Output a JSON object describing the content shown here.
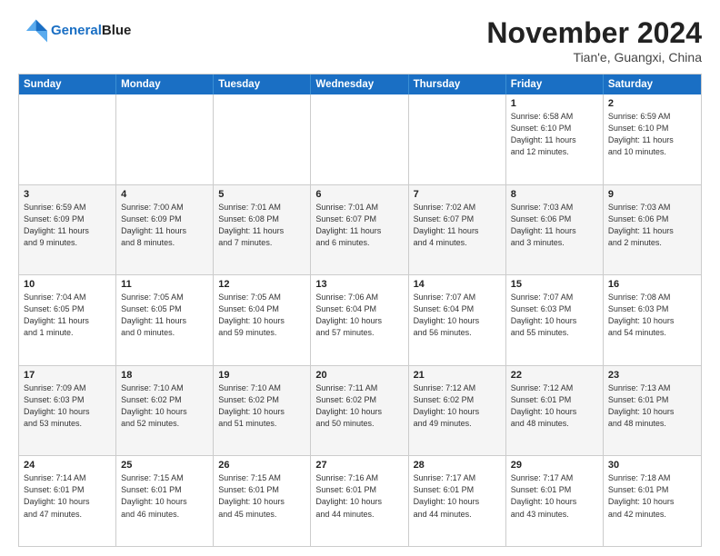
{
  "header": {
    "logo_line1": "General",
    "logo_line2": "Blue",
    "month_title": "November 2024",
    "location": "Tian'e, Guangxi, China"
  },
  "weekdays": [
    "Sunday",
    "Monday",
    "Tuesday",
    "Wednesday",
    "Thursday",
    "Friday",
    "Saturday"
  ],
  "rows": [
    [
      {
        "day": "",
        "info": ""
      },
      {
        "day": "",
        "info": ""
      },
      {
        "day": "",
        "info": ""
      },
      {
        "day": "",
        "info": ""
      },
      {
        "day": "",
        "info": ""
      },
      {
        "day": "1",
        "info": "Sunrise: 6:58 AM\nSunset: 6:10 PM\nDaylight: 11 hours\nand 12 minutes."
      },
      {
        "day": "2",
        "info": "Sunrise: 6:59 AM\nSunset: 6:10 PM\nDaylight: 11 hours\nand 10 minutes."
      }
    ],
    [
      {
        "day": "3",
        "info": "Sunrise: 6:59 AM\nSunset: 6:09 PM\nDaylight: 11 hours\nand 9 minutes."
      },
      {
        "day": "4",
        "info": "Sunrise: 7:00 AM\nSunset: 6:09 PM\nDaylight: 11 hours\nand 8 minutes."
      },
      {
        "day": "5",
        "info": "Sunrise: 7:01 AM\nSunset: 6:08 PM\nDaylight: 11 hours\nand 7 minutes."
      },
      {
        "day": "6",
        "info": "Sunrise: 7:01 AM\nSunset: 6:07 PM\nDaylight: 11 hours\nand 6 minutes."
      },
      {
        "day": "7",
        "info": "Sunrise: 7:02 AM\nSunset: 6:07 PM\nDaylight: 11 hours\nand 4 minutes."
      },
      {
        "day": "8",
        "info": "Sunrise: 7:03 AM\nSunset: 6:06 PM\nDaylight: 11 hours\nand 3 minutes."
      },
      {
        "day": "9",
        "info": "Sunrise: 7:03 AM\nSunset: 6:06 PM\nDaylight: 11 hours\nand 2 minutes."
      }
    ],
    [
      {
        "day": "10",
        "info": "Sunrise: 7:04 AM\nSunset: 6:05 PM\nDaylight: 11 hours\nand 1 minute."
      },
      {
        "day": "11",
        "info": "Sunrise: 7:05 AM\nSunset: 6:05 PM\nDaylight: 11 hours\nand 0 minutes."
      },
      {
        "day": "12",
        "info": "Sunrise: 7:05 AM\nSunset: 6:04 PM\nDaylight: 10 hours\nand 59 minutes."
      },
      {
        "day": "13",
        "info": "Sunrise: 7:06 AM\nSunset: 6:04 PM\nDaylight: 10 hours\nand 57 minutes."
      },
      {
        "day": "14",
        "info": "Sunrise: 7:07 AM\nSunset: 6:04 PM\nDaylight: 10 hours\nand 56 minutes."
      },
      {
        "day": "15",
        "info": "Sunrise: 7:07 AM\nSunset: 6:03 PM\nDaylight: 10 hours\nand 55 minutes."
      },
      {
        "day": "16",
        "info": "Sunrise: 7:08 AM\nSunset: 6:03 PM\nDaylight: 10 hours\nand 54 minutes."
      }
    ],
    [
      {
        "day": "17",
        "info": "Sunrise: 7:09 AM\nSunset: 6:03 PM\nDaylight: 10 hours\nand 53 minutes."
      },
      {
        "day": "18",
        "info": "Sunrise: 7:10 AM\nSunset: 6:02 PM\nDaylight: 10 hours\nand 52 minutes."
      },
      {
        "day": "19",
        "info": "Sunrise: 7:10 AM\nSunset: 6:02 PM\nDaylight: 10 hours\nand 51 minutes."
      },
      {
        "day": "20",
        "info": "Sunrise: 7:11 AM\nSunset: 6:02 PM\nDaylight: 10 hours\nand 50 minutes."
      },
      {
        "day": "21",
        "info": "Sunrise: 7:12 AM\nSunset: 6:02 PM\nDaylight: 10 hours\nand 49 minutes."
      },
      {
        "day": "22",
        "info": "Sunrise: 7:12 AM\nSunset: 6:01 PM\nDaylight: 10 hours\nand 48 minutes."
      },
      {
        "day": "23",
        "info": "Sunrise: 7:13 AM\nSunset: 6:01 PM\nDaylight: 10 hours\nand 48 minutes."
      }
    ],
    [
      {
        "day": "24",
        "info": "Sunrise: 7:14 AM\nSunset: 6:01 PM\nDaylight: 10 hours\nand 47 minutes."
      },
      {
        "day": "25",
        "info": "Sunrise: 7:15 AM\nSunset: 6:01 PM\nDaylight: 10 hours\nand 46 minutes."
      },
      {
        "day": "26",
        "info": "Sunrise: 7:15 AM\nSunset: 6:01 PM\nDaylight: 10 hours\nand 45 minutes."
      },
      {
        "day": "27",
        "info": "Sunrise: 7:16 AM\nSunset: 6:01 PM\nDaylight: 10 hours\nand 44 minutes."
      },
      {
        "day": "28",
        "info": "Sunrise: 7:17 AM\nSunset: 6:01 PM\nDaylight: 10 hours\nand 44 minutes."
      },
      {
        "day": "29",
        "info": "Sunrise: 7:17 AM\nSunset: 6:01 PM\nDaylight: 10 hours\nand 43 minutes."
      },
      {
        "day": "30",
        "info": "Sunrise: 7:18 AM\nSunset: 6:01 PM\nDaylight: 10 hours\nand 42 minutes."
      }
    ]
  ]
}
